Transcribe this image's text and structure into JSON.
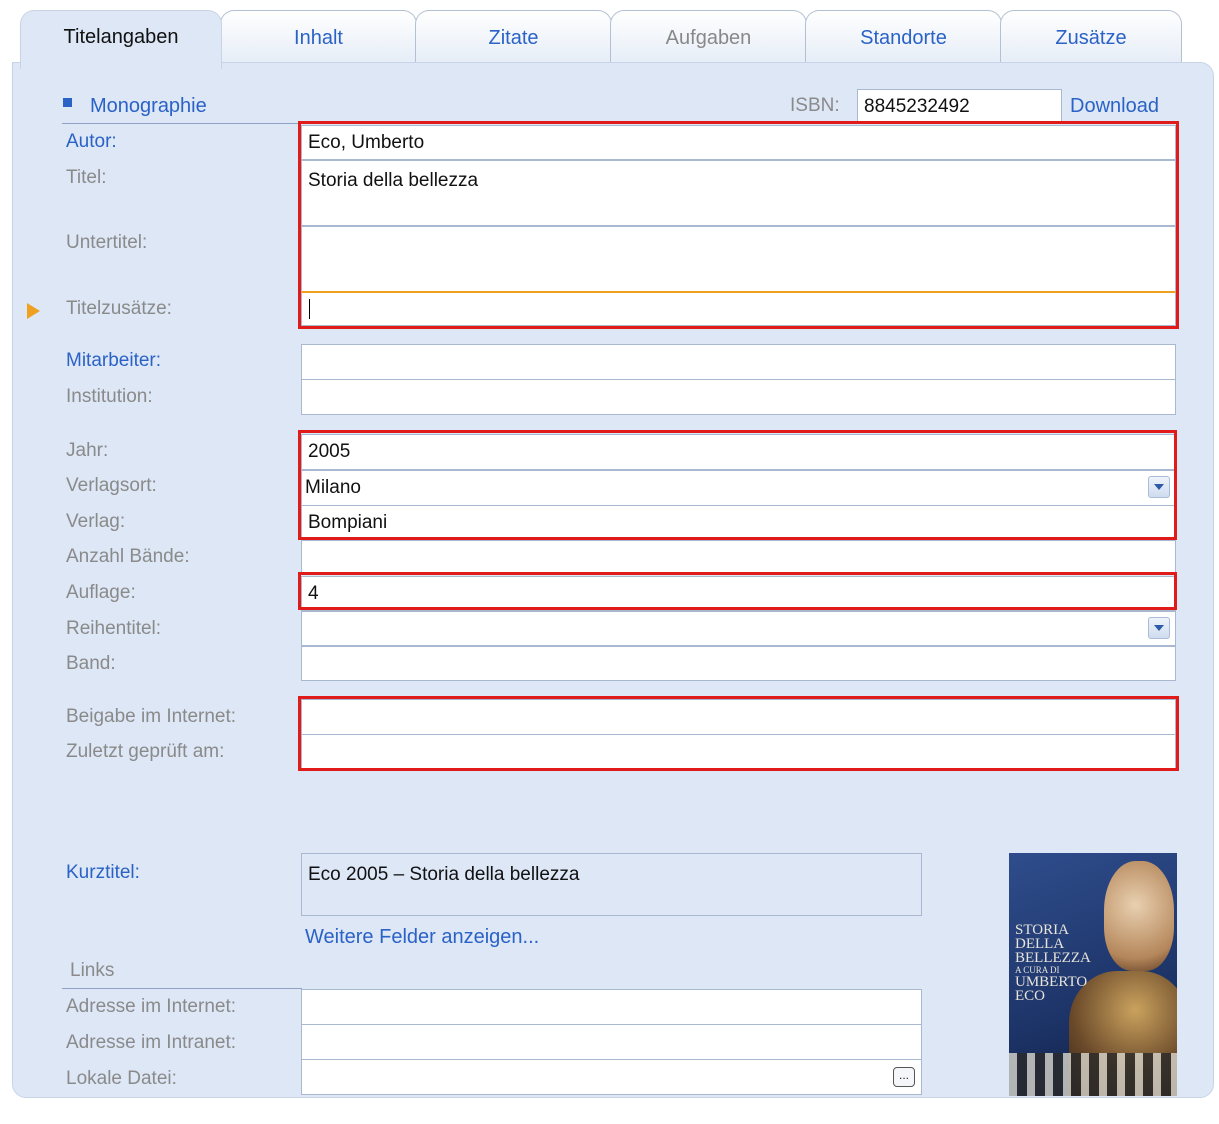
{
  "tabs": [
    {
      "label": "Titelangaben"
    },
    {
      "label": "Inhalt"
    },
    {
      "label": "Zitate"
    },
    {
      "label": "Aufgaben"
    },
    {
      "label": "Standorte"
    },
    {
      "label": "Zusätze"
    }
  ],
  "header": {
    "type_label": "Monographie",
    "isbn_label": "ISBN:",
    "isbn_value": "8845232492",
    "download_label": "Download"
  },
  "fields": {
    "autor_label": "Autor:",
    "autor_value": "Eco, Umberto",
    "titel_label": "Titel:",
    "titel_value": "Storia della bellezza",
    "untertitel_label": "Untertitel:",
    "untertitel_value": "",
    "titelzusaetze_label": "Titelzusätze:",
    "titelzusaetze_value": "",
    "mitarbeiter_label": "Mitarbeiter:",
    "mitarbeiter_value": "",
    "institution_label": "Institution:",
    "institution_value": "",
    "jahr_label": "Jahr:",
    "jahr_value": "2005",
    "verlagsort_label": "Verlagsort:",
    "verlagsort_value": "Milano",
    "verlag_label": "Verlag:",
    "verlag_value": "Bompiani",
    "anzahl_label": "Anzahl Bände:",
    "anzahl_value": "",
    "auflage_label": "Auflage:",
    "auflage_value": "4",
    "reihentitel_label": "Reihentitel:",
    "reihentitel_value": "",
    "band_label": "Band:",
    "band_value": "",
    "beigabe_label": "Beigabe im Internet:",
    "beigabe_value": "",
    "geprueft_label": "Zuletzt geprüft am:",
    "geprueft_value": "",
    "kurztitel_label": "Kurztitel:",
    "kurztitel_value": "Eco 2005 – Storia della bellezza"
  },
  "more_fields_link": "Weitere Felder anzeigen...",
  "links": {
    "section_label": "Links",
    "internet_label": "Adresse im Internet:",
    "internet_value": "",
    "intranet_label": "Adresse im Intranet:",
    "intranet_value": "",
    "datei_label": "Lokale Datei:",
    "datei_value": "",
    "browse_label": "..."
  },
  "cover": {
    "lines": [
      "STORIA",
      "DELLA",
      "BELLEZZA",
      "A CURA DI",
      "UMBERTO",
      "ECO"
    ]
  },
  "colors": {
    "accent": "#2a62c6",
    "panel": "#dde7f6",
    "highlight": "#e11a1a",
    "current_arrow": "#f0a020"
  }
}
